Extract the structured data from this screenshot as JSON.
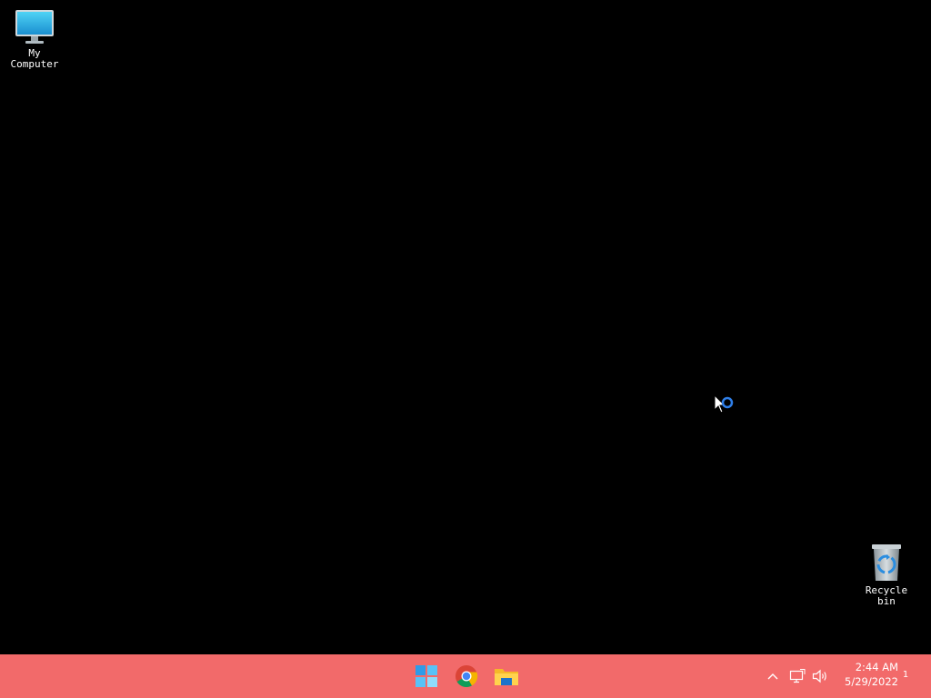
{
  "desktop": {
    "background_color": "#000000",
    "icons": [
      {
        "label": "My\nComputer",
        "icon": "monitor-icon"
      },
      {
        "label": "Recycle\nbin",
        "icon": "recycle-bin-icon"
      }
    ]
  },
  "cursor": {
    "icon": "busy-cursor-icon"
  },
  "taskbar": {
    "background_color": "#f26a6a",
    "apps": [
      {
        "name": "Start",
        "icon": "windows-start-icon"
      },
      {
        "name": "Google Chrome",
        "icon": "chrome-icon"
      },
      {
        "name": "File Explorer",
        "icon": "folder-icon"
      }
    ],
    "tray": {
      "icons": [
        "chevron-up-icon",
        "network-icon",
        "volume-icon"
      ],
      "time": "2:44 AM",
      "date": "5/29/2022",
      "notification_count": "1"
    }
  }
}
